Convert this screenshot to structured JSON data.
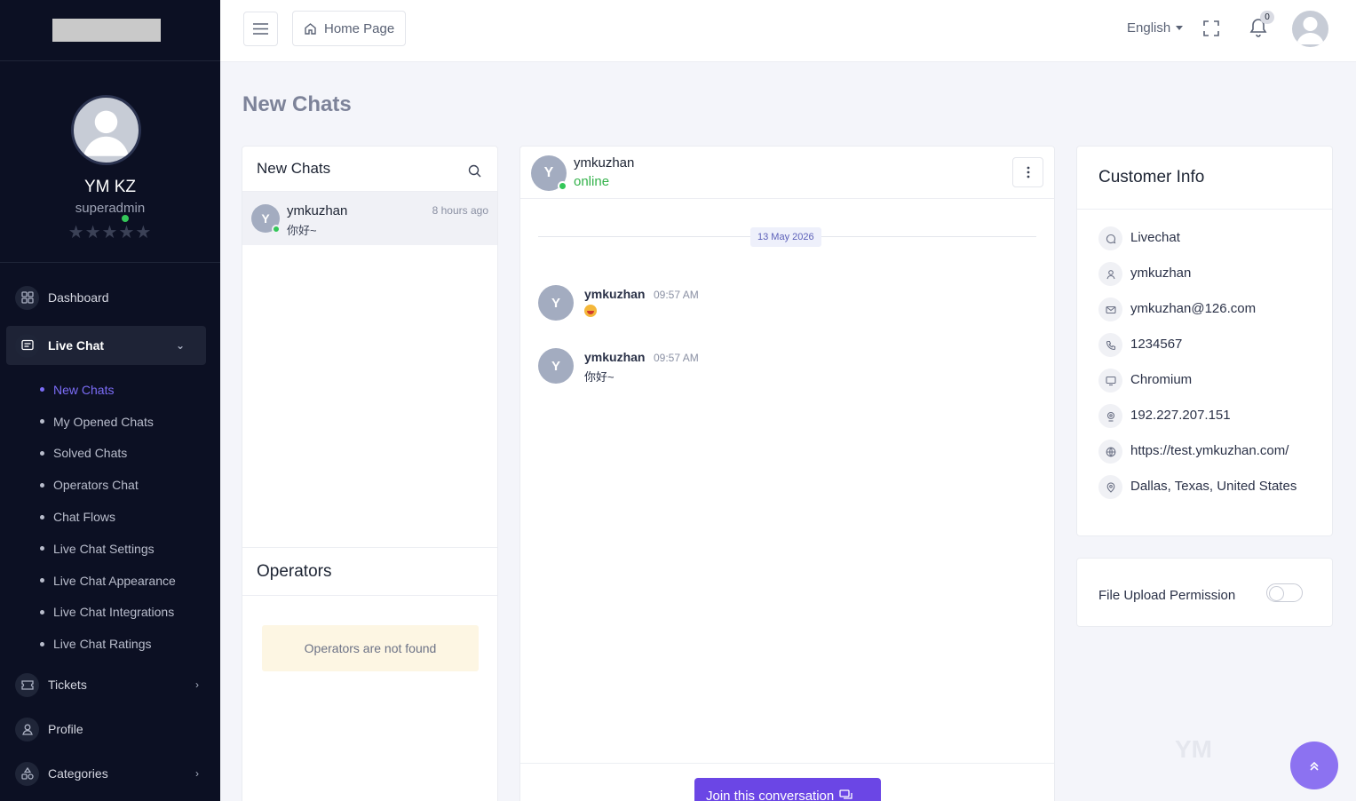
{
  "sidebar": {
    "profile": {
      "name": "YM KZ",
      "role": "superadmin",
      "stars": "★★★★★"
    },
    "menu": {
      "dashboard": "Dashboard",
      "live_chat": "Live Chat",
      "sub": [
        "New Chats",
        "My Opened Chats",
        "Solved Chats",
        "Operators Chat",
        "Chat Flows",
        "Live Chat Settings",
        "Live Chat Appearance",
        "Live Chat Integrations",
        "Live Chat Ratings"
      ],
      "tickets": "Tickets",
      "profile": "Profile",
      "categories": "Categories"
    }
  },
  "topbar": {
    "home": "Home Page",
    "language": "English",
    "notifications_count": "0"
  },
  "page": {
    "title": "New Chats"
  },
  "chats": {
    "title": "New Chats",
    "items": [
      {
        "initial": "Y",
        "name": "ymkuzhan",
        "time": "8 hours ago",
        "preview": "你好~"
      }
    ]
  },
  "operators": {
    "title": "Operators",
    "empty": "Operators are not found"
  },
  "conversation": {
    "initial": "Y",
    "name": "ymkuzhan",
    "status": "online",
    "date": "13 May 2026",
    "messages": [
      {
        "initial": "Y",
        "name": "ymkuzhan",
        "time": "09:57 AM",
        "text": ""
      },
      {
        "initial": "Y",
        "name": "ymkuzhan",
        "time": "09:57 AM",
        "text": "你好~"
      }
    ],
    "join_label": "Join this conversation"
  },
  "customer": {
    "title": "Customer Info",
    "source": "Livechat",
    "name": "ymkuzhan",
    "email": "ymkuzhan@126.com",
    "phone": "1234567",
    "browser": "Chromium",
    "ip": "192.227.207.151",
    "url": "https://test.ymkuzhan.com/",
    "location": "Dallas, Texas, United States"
  },
  "permissions": {
    "file_upload": "File Upload Permission"
  },
  "colors": {
    "accent": "#6b46e5",
    "sidebar": "#0c1023",
    "online": "#34c759"
  }
}
